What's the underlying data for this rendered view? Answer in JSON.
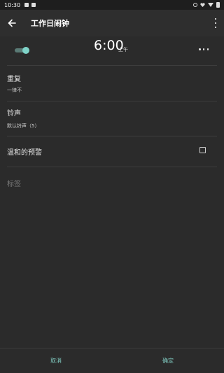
{
  "status_bar": {
    "time": "10:30"
  },
  "app_bar": {
    "title": "工作日闹钟"
  },
  "alarm": {
    "enabled": true,
    "time": "6:00",
    "period": "上午"
  },
  "repeat": {
    "label": "重复",
    "value": "一律不"
  },
  "ringtone": {
    "label": "铃声",
    "value": "默认铃声（5）"
  },
  "gentle_alert": {
    "label": "温和的预警",
    "checked": false
  },
  "tag": {
    "placeholder": "标签"
  },
  "actions": {
    "cancel": "取消",
    "confirm": "确定"
  },
  "colors": {
    "accent": "#7fd3c8",
    "background": "#2b2b2b"
  }
}
